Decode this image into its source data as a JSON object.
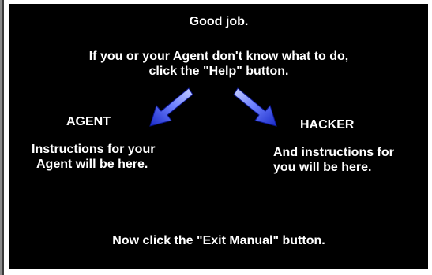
{
  "screen": {
    "title": "Good job.",
    "help_line_1": "If you or your Agent don't know what to do,",
    "help_line_2": "click the \"Help\" button.",
    "exit_instruction": "Now click the \"Exit Manual\" button."
  },
  "agent": {
    "heading": "AGENT",
    "line_1": "Instructions for your",
    "line_2": "Agent will be here."
  },
  "hacker": {
    "heading": "HACKER",
    "line_1": "And instructions for",
    "line_2": "you will be here."
  },
  "icons": {
    "left_arrow": "arrow-down-left-icon",
    "right_arrow": "arrow-down-right-icon"
  },
  "colors": {
    "background": "#000000",
    "text": "#ffffff",
    "arrow_light": "#9aa8ff",
    "arrow_dark": "#1f2fd0"
  }
}
